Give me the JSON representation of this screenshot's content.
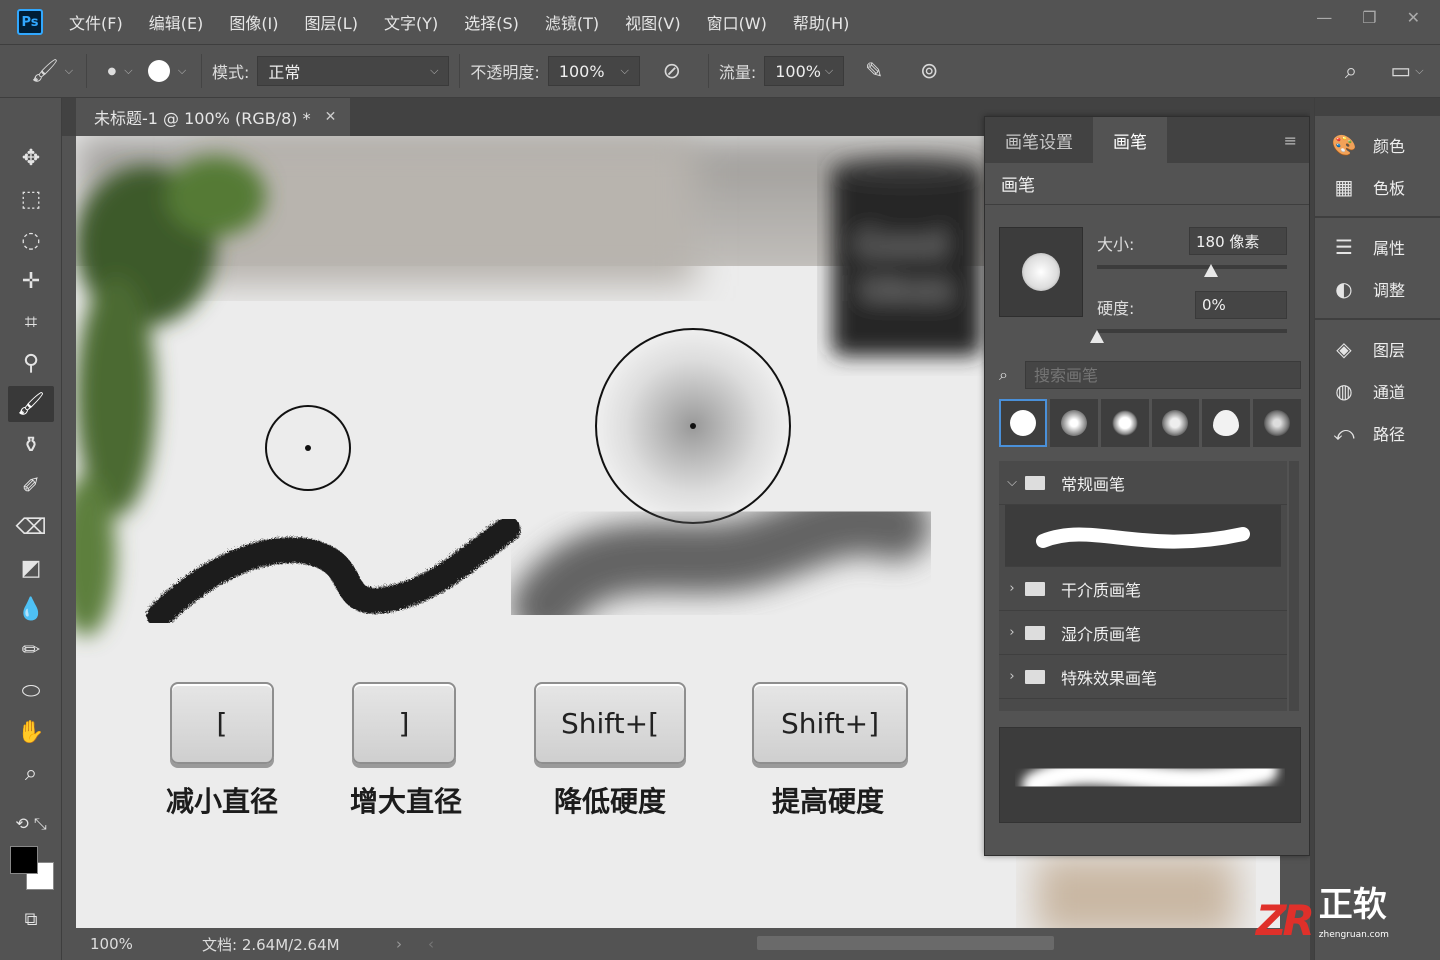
{
  "app": {
    "logo": "Ps"
  },
  "menu": [
    "文件(F)",
    "编辑(E)",
    "图像(I)",
    "图层(L)",
    "文字(Y)",
    "选择(S)",
    "滤镜(T)",
    "视图(V)",
    "窗口(W)",
    "帮助(H)"
  ],
  "options": {
    "mode_label": "模式:",
    "mode_value": "正常",
    "opacity_label": "不透明度:",
    "opacity_value": "100%",
    "flow_label": "流量:",
    "flow_value": "100%"
  },
  "document": {
    "tab_title": "未标题-1 @ 100% (RGB/8) *",
    "mug_text_line1": "Good",
    "mug_text_line2": "Ideas"
  },
  "keys": [
    {
      "key": "[",
      "label": "减小直径"
    },
    {
      "key": "]",
      "label": "增大直径"
    },
    {
      "key": "Shift+[",
      "label": "降低硬度"
    },
    {
      "key": "Shift+]",
      "label": "提高硬度"
    }
  ],
  "status": {
    "zoom": "100%",
    "doc_info": "文档: 2.64M/2.64M"
  },
  "brush_panel": {
    "tabs": [
      "画笔设置",
      "画笔"
    ],
    "active_tab": "画笔",
    "sub_header": "画笔",
    "size_label": "大小:",
    "size_value": "180 像素",
    "size_slider_fraction": 0.6,
    "hardness_label": "硬度:",
    "hardness_value": "0%",
    "hardness_slider_fraction": 0.0,
    "search_placeholder": "搜索画笔",
    "folders": [
      "常规画笔",
      "干介质画笔",
      "湿介质画笔",
      "特殊效果画笔"
    ]
  },
  "dock": {
    "group1": [
      {
        "icon": "palette-icon",
        "label": "颜色"
      },
      {
        "icon": "swatches-icon",
        "label": "色板"
      }
    ],
    "group2": [
      {
        "icon": "properties-icon",
        "label": "属性"
      },
      {
        "icon": "adjustments-icon",
        "label": "调整"
      }
    ],
    "group3": [
      {
        "icon": "layers-icon",
        "label": "图层"
      },
      {
        "icon": "channels-icon",
        "label": "通道"
      },
      {
        "icon": "paths-icon",
        "label": "路径"
      }
    ]
  },
  "watermark": {
    "mark": "ZR",
    "name": "正软",
    "url": "zhengruan.com"
  },
  "colors": {
    "accent": "#31a8ff",
    "watermark_red": "#e0302a",
    "panel_bg": "#535353"
  }
}
